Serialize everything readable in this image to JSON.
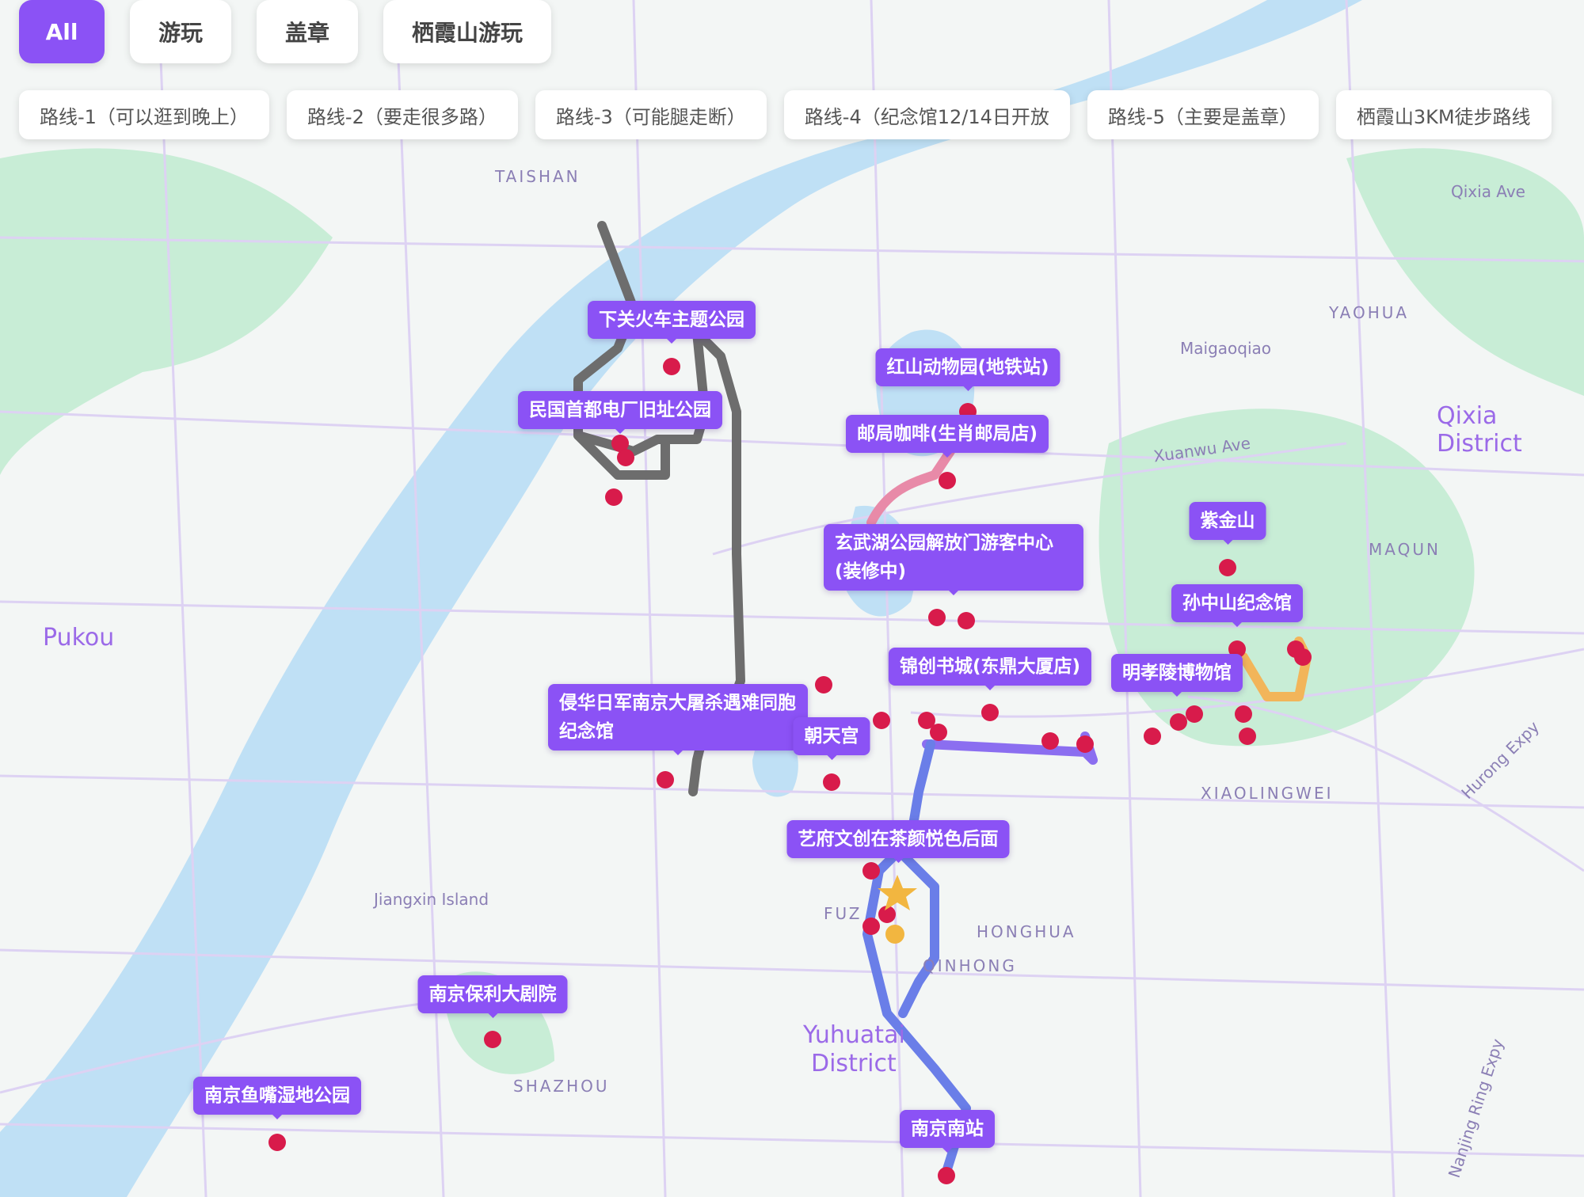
{
  "category_tabs": [
    "All",
    "游玩",
    "盖章",
    "栖霞山游玩"
  ],
  "active_tab": "All",
  "routes": [
    "路线-1（可以逛到晚上）",
    "路线-2（要走很多路）",
    "路线-3（可能腿走断）",
    "路线-4（纪念馆12/14日开放",
    "路线-5（主要是盖章）",
    "栖霞山3KM徒步路线"
  ],
  "places": [
    "下关火车主题公园",
    "民国首都电厂旧址公园",
    "红山动物园(地铁站)",
    "邮局咖啡(生肖邮局店)",
    "玄武湖公园解放门游客中心(装修中)",
    "紫金山",
    "孙中山纪念馆",
    "锦创书城(东鼎大厦店)",
    "明孝陵博物馆",
    "侵华日军南京大屠杀遇难同胞纪念馆",
    "朝天宫",
    "艺府文创在茶颜悦色后面",
    "南京保利大剧院",
    "南京鱼嘴湿地公园",
    "南京南站"
  ],
  "map_labels": {
    "areas": [
      "TAISHAN",
      "YAOHUA",
      "Maigaoqiao",
      "MAQUN",
      "XIAOLINGWEI",
      "HONGHUA",
      "QINHONG",
      "SHAZHOU",
      "FUZ"
    ],
    "districts": [
      "Pukou",
      "Qixia District",
      "Yuhuatai",
      "District"
    ],
    "roads": [
      "Qixia Ave",
      "Xuanwu Ave",
      "Hurong Expy",
      "Nanjing Ring Expy",
      "Jiangxin Island"
    ]
  },
  "colors": {
    "accent": "#8b52f5",
    "pin": "#d81b4b",
    "water": "#bfe0f5",
    "green": "#c8edd6",
    "route_gray": "#6d6d6d",
    "route_blue": "#6a7ee8",
    "route_pink": "#e88aa8",
    "route_orange": "#f2b55a"
  }
}
